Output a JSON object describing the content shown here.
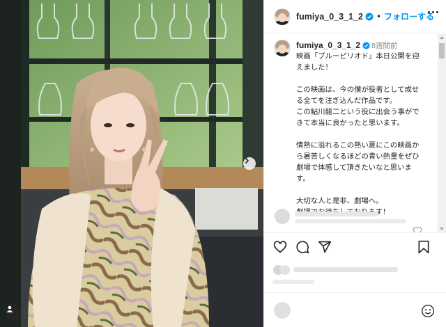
{
  "post": {
    "author": "fumiya_0_3_1_2",
    "follow_label": "フォローする",
    "separator": "•",
    "posted_ago": "8週間前",
    "caption_lines": [
      "映画「ブルーピリオド」本日公開を迎",
      "えました！",
      "",
      "この映画は、今の僕が役者として成せ",
      "る全てを注ぎ込んだ作品です。",
      "この鮎川龍二という役に出会う事がで",
      "きて本当に良かったと思います。",
      "",
      "情熱に溢れるこの熱い夏にこの映画か",
      "ら暑苦しくなるほどの青い熱量をぜひ",
      "劇場で体感して頂きたいなと思いま",
      "す。",
      "",
      "大切な人と是非、劇場へ。",
      "劇場でお待ちしております！"
    ]
  },
  "icons": {
    "verified": "verified-badge-icon",
    "more": "more-options-icon",
    "like": "heart-icon",
    "comment": "comment-icon",
    "share": "share-icon",
    "save": "bookmark-icon",
    "emoji": "emoji-icon",
    "next": "chevron-right-icon",
    "tag": "tagged-user-icon"
  },
  "colors": {
    "accent": "#0095f6",
    "text": "#262626",
    "muted": "#8e8e8e",
    "divider": "#efefef"
  }
}
